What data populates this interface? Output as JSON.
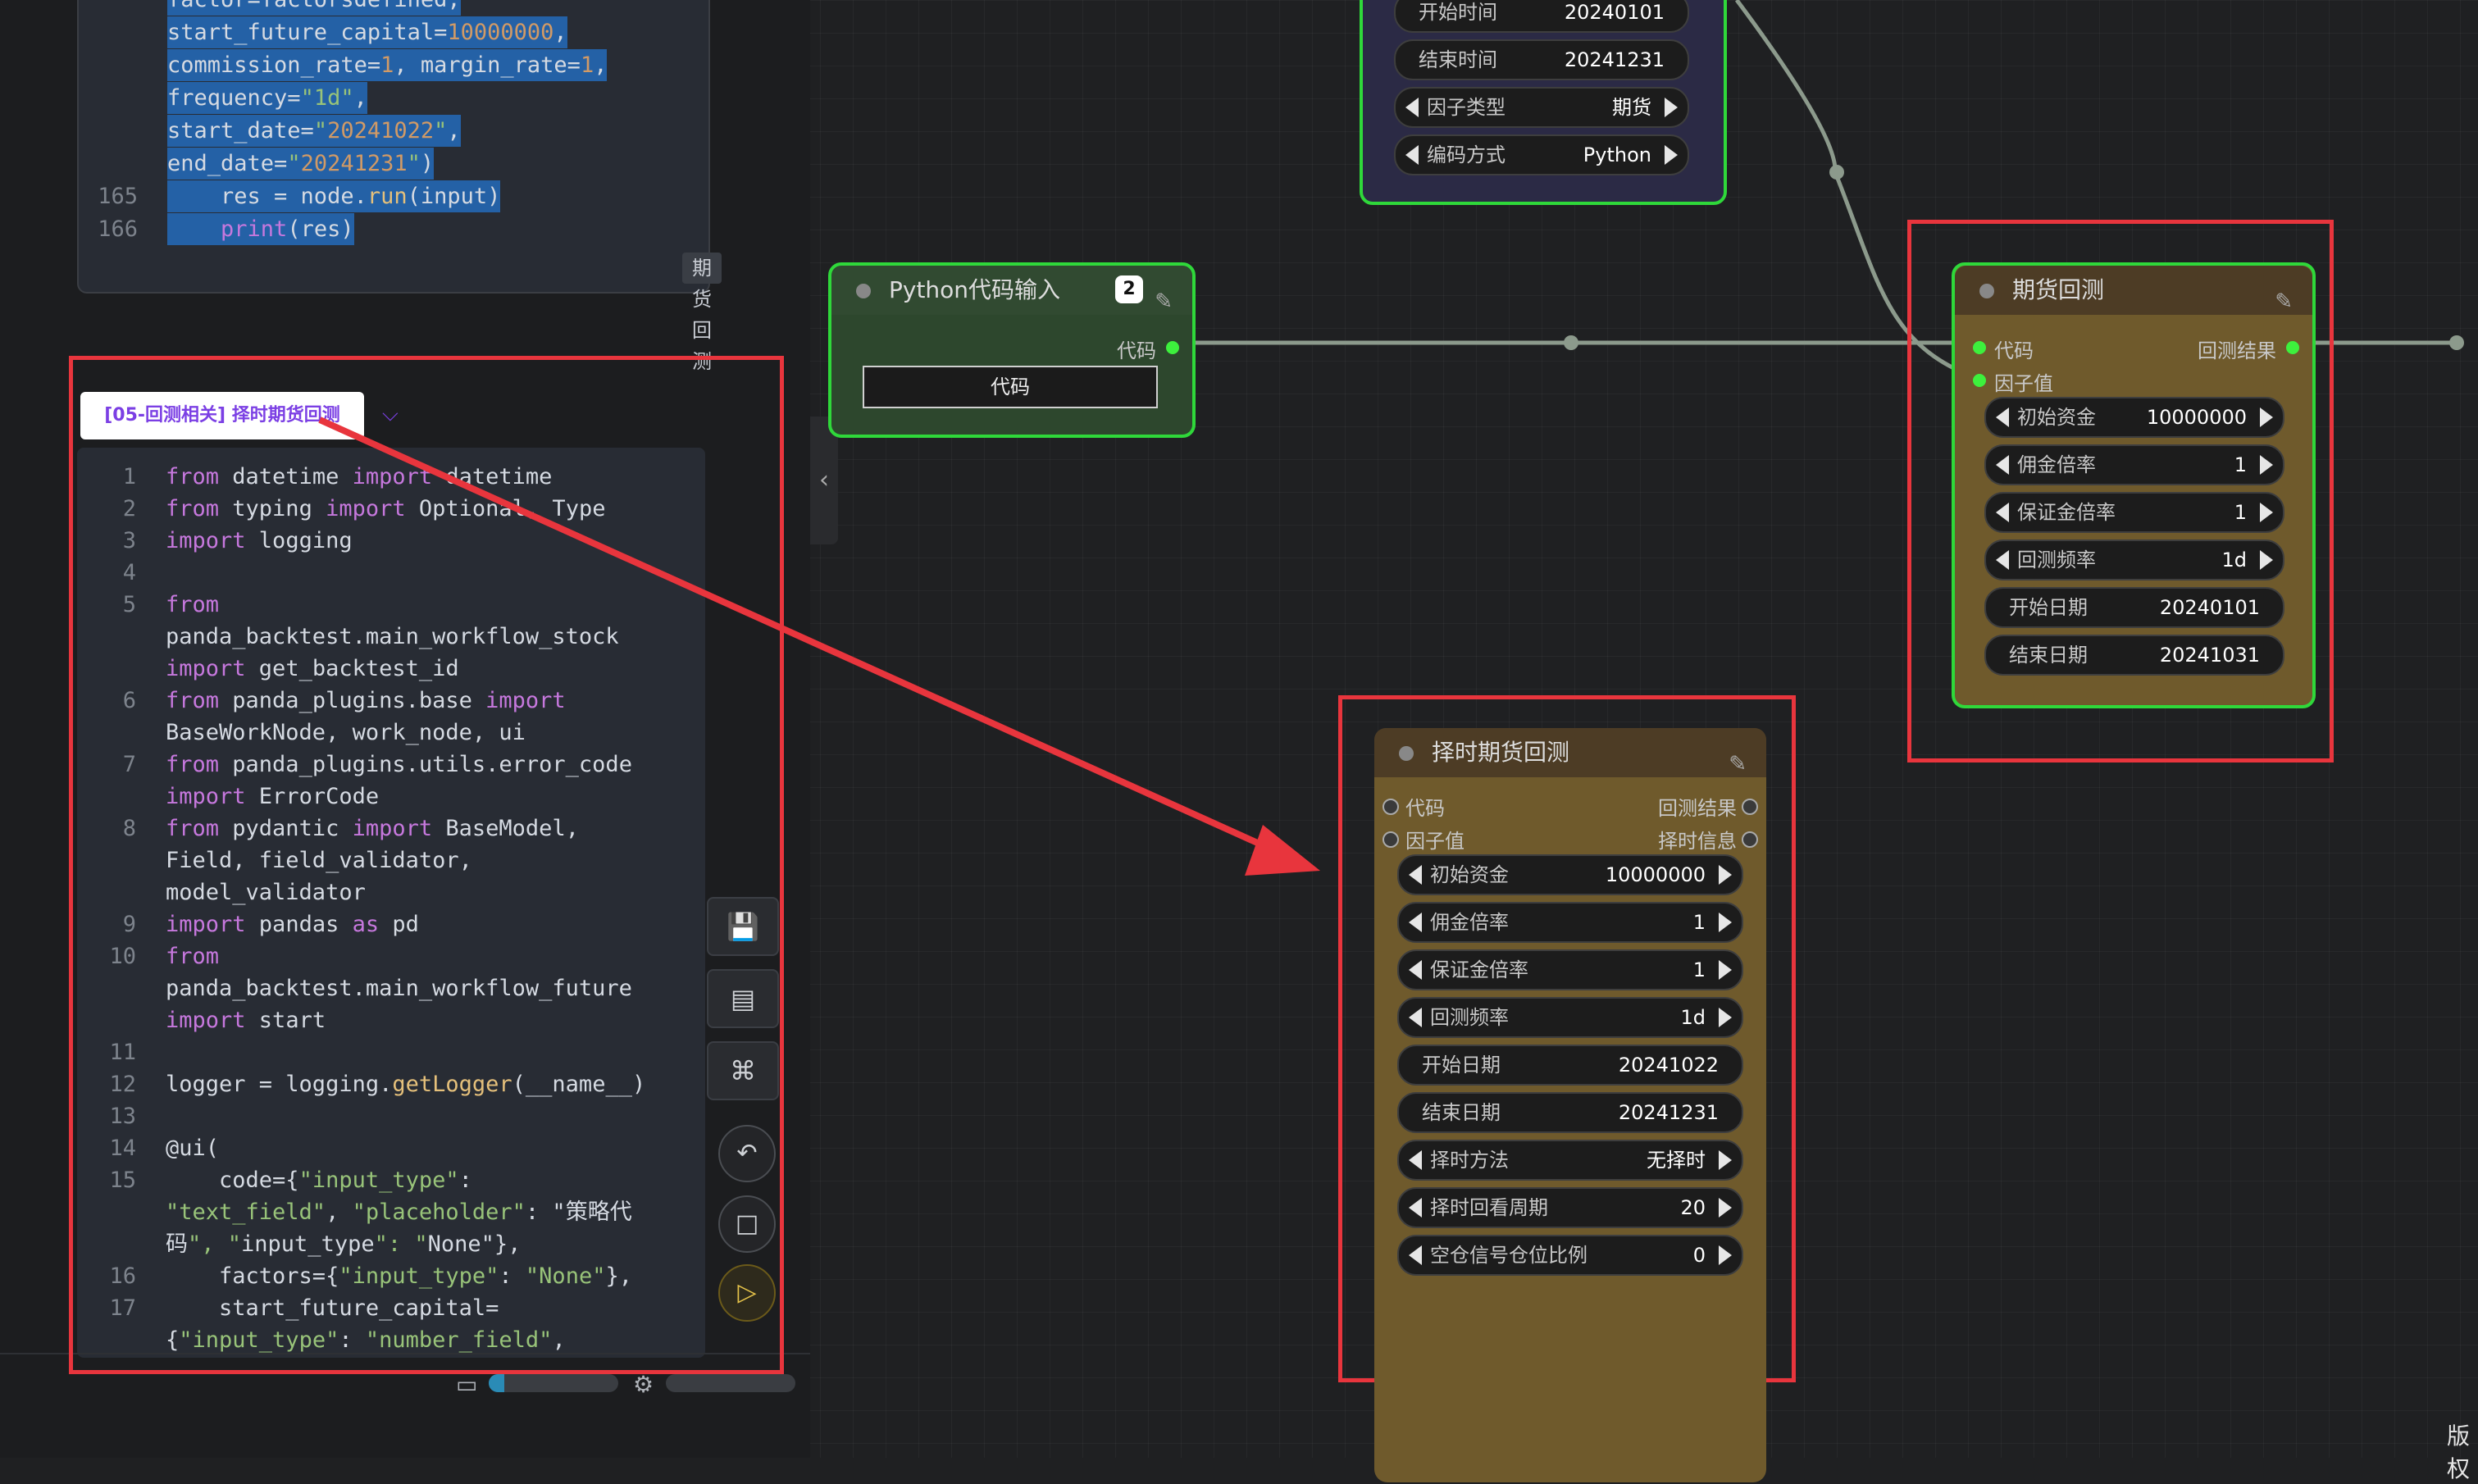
{
  "editor_top": {
    "lines": [
      {
        "ln": "",
        "text": "factor=factorsdefined,"
      },
      {
        "ln": "",
        "text": "start_future_capital=10000000,"
      },
      {
        "ln": "",
        "text": "commission_rate=1, margin_rate=1,"
      },
      {
        "ln": "",
        "text": "frequency=\"1d\","
      },
      {
        "ln": "",
        "text": "start_date=\"20241022\","
      },
      {
        "ln": "",
        "text": "end_date=\"20241231\")"
      },
      {
        "ln": "165",
        "text": "    res = node.run(input)"
      },
      {
        "ln": "166",
        "text": "    print(res)"
      }
    ],
    "tag": "期货回测"
  },
  "file_tab": {
    "label": "[05-回测相关] 择时期货回测"
  },
  "editor_main": {
    "lines": [
      {
        "ln": "1",
        "text": "from datetime import datetime"
      },
      {
        "ln": "2",
        "text": "from typing import Optional, Type"
      },
      {
        "ln": "3",
        "text": "import logging"
      },
      {
        "ln": "4",
        "text": ""
      },
      {
        "ln": "5",
        "text": "from"
      },
      {
        "ln": "",
        "text": "panda_backtest.main_workflow_stock"
      },
      {
        "ln": "",
        "text": "import get_backtest_id"
      },
      {
        "ln": "6",
        "text": "from panda_plugins.base import"
      },
      {
        "ln": "",
        "text": "BaseWorkNode, work_node, ui"
      },
      {
        "ln": "7",
        "text": "from panda_plugins.utils.error_code"
      },
      {
        "ln": "",
        "text": "import ErrorCode"
      },
      {
        "ln": "8",
        "text": "from pydantic import BaseModel,"
      },
      {
        "ln": "",
        "text": "Field, field_validator,"
      },
      {
        "ln": "",
        "text": "model_validator"
      },
      {
        "ln": "9",
        "text": "import pandas as pd"
      },
      {
        "ln": "10",
        "text": "from"
      },
      {
        "ln": "",
        "text": "panda_backtest.main_workflow_future"
      },
      {
        "ln": "",
        "text": "import start"
      },
      {
        "ln": "11",
        "text": ""
      },
      {
        "ln": "12",
        "text": "logger = logging.getLogger(__name__)"
      },
      {
        "ln": "13",
        "text": ""
      },
      {
        "ln": "14",
        "text": "@ui("
      },
      {
        "ln": "15",
        "text": "    code={\"input_type\":"
      },
      {
        "ln": "",
        "text": "\"text_field\", \"placeholder\": \"策略代"
      },
      {
        "ln": "",
        "text": "码\", \"input_type\": \"None\"},"
      },
      {
        "ln": "16",
        "text": "    factors={\"input_type\": \"None\"},"
      },
      {
        "ln": "17",
        "text": "    start_future_capital="
      },
      {
        "ln": "",
        "text": "{\"input_type\": \"number_field\","
      }
    ]
  },
  "toolbar": {
    "save": "save-icon",
    "layout": "layout-icon",
    "command": "command-icon",
    "undo": "undo-icon",
    "stop": "stop-icon",
    "run": "play-icon"
  },
  "status": {
    "mem_percent": 12,
    "cpu_percent": 0
  },
  "node_top": {
    "widgets": [
      {
        "label": "开始时间",
        "value": "20240101",
        "arrows": false
      },
      {
        "label": "结束时间",
        "value": "20241231",
        "arrows": false
      },
      {
        "label": "因子类型",
        "value": "期货",
        "arrows": true
      },
      {
        "label": "编码方式",
        "value": "Python",
        "arrows": true
      }
    ]
  },
  "node_python": {
    "title": "Python代码输入",
    "badge": "2",
    "out_label": "代码",
    "button": "代码"
  },
  "node_futures": {
    "title": "期货回测",
    "inputs": [
      "代码",
      "因子值"
    ],
    "output": "回测结果",
    "widgets": [
      {
        "label": "初始资金",
        "value": "10000000",
        "arrows": true
      },
      {
        "label": "佣金倍率",
        "value": "1",
        "arrows": true
      },
      {
        "label": "保证金倍率",
        "value": "1",
        "arrows": true
      },
      {
        "label": "回测频率",
        "value": "1d",
        "arrows": true
      },
      {
        "label": "开始日期",
        "value": "20240101",
        "arrows": false
      },
      {
        "label": "结束日期",
        "value": "20241031",
        "arrows": false
      }
    ]
  },
  "node_timing": {
    "title": "择时期货回测",
    "inputs": [
      "代码",
      "因子值"
    ],
    "outputs": [
      "回测结果",
      "择时信息"
    ],
    "widgets": [
      {
        "label": "初始资金",
        "value": "10000000",
        "arrows": true
      },
      {
        "label": "佣金倍率",
        "value": "1",
        "arrows": true
      },
      {
        "label": "保证金倍率",
        "value": "1",
        "arrows": true
      },
      {
        "label": "回测频率",
        "value": "1d",
        "arrows": true
      },
      {
        "label": "开始日期",
        "value": "20241022",
        "arrows": false
      },
      {
        "label": "结束日期",
        "value": "20241231",
        "arrows": false
      },
      {
        "label": "择时方法",
        "value": "无择时",
        "arrows": true
      },
      {
        "label": "择时回看周期",
        "value": "20",
        "arrows": true
      },
      {
        "label": "空仓信号仓位比例",
        "value": "0",
        "arrows": true
      }
    ]
  },
  "watermark": "版权"
}
